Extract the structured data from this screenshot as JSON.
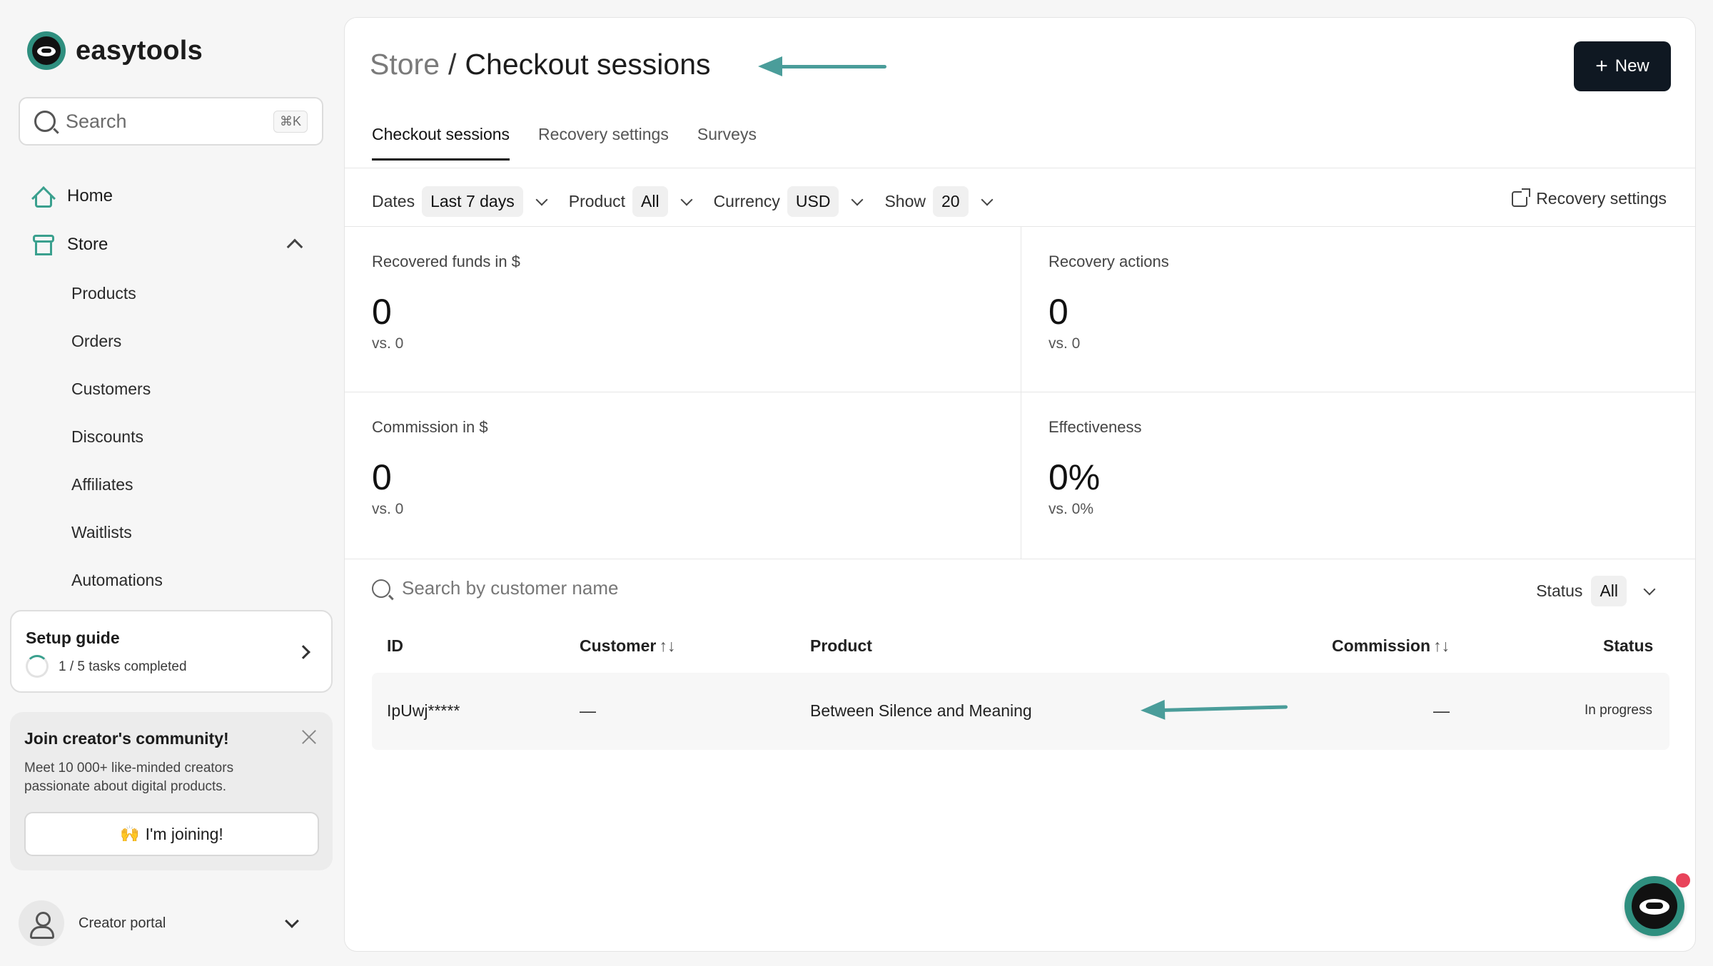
{
  "app": {
    "name": "easytools"
  },
  "search": {
    "label": "Search",
    "shortcut": "⌘K"
  },
  "nav": {
    "home": "Home",
    "store": "Store",
    "store_items": [
      "Products",
      "Orders",
      "Customers",
      "Discounts",
      "Affiliates",
      "Waitlists",
      "Automations"
    ]
  },
  "setup_guide": {
    "title": "Setup guide",
    "progress_text": "1 / 5 tasks completed",
    "completed": 1,
    "total": 5
  },
  "community": {
    "title": "Join creator's community!",
    "text": "Meet 10 000+ like-minded creators passionate about digital products.",
    "button": "I'm joining!"
  },
  "portal": {
    "label": "Creator portal"
  },
  "page": {
    "breadcrumb_parent": "Store",
    "separator": "/",
    "title": "Checkout sessions",
    "new_button": "New"
  },
  "tabs": [
    "Checkout sessions",
    "Recovery settings",
    "Surveys"
  ],
  "filters": {
    "dates": {
      "label": "Dates",
      "value": "Last 7 days"
    },
    "product": {
      "label": "Product",
      "value": "All"
    },
    "currency": {
      "label": "Currency",
      "value": "USD"
    },
    "show": {
      "label": "Show",
      "value": "20"
    },
    "recovery_link": "Recovery settings"
  },
  "stats": [
    {
      "label": "Recovered funds in $",
      "value": "0",
      "vs": "vs. 0"
    },
    {
      "label": "Recovery actions",
      "value": "0",
      "vs": "vs. 0"
    },
    {
      "label": "Commission in $",
      "value": "0",
      "vs": "vs. 0"
    },
    {
      "label": "Effectiveness",
      "value": "0%",
      "vs": "vs. 0%"
    }
  ],
  "table": {
    "search_placeholder": "Search by customer name",
    "status_filter": {
      "label": "Status",
      "value": "All"
    },
    "columns": [
      "ID",
      "Customer",
      "Product",
      "Commission",
      "Status"
    ],
    "sort_glyph": "↑↓",
    "rows": [
      {
        "id": "IpUwj*****",
        "customer": "—",
        "product": "Between Silence and Meaning",
        "commission": "—",
        "status": "In progress"
      }
    ]
  },
  "colors": {
    "accent": "#3aa08e",
    "annotation_arrow": "#4a9d9a",
    "primary_button": "#0f1822",
    "notification": "#e8435a"
  }
}
